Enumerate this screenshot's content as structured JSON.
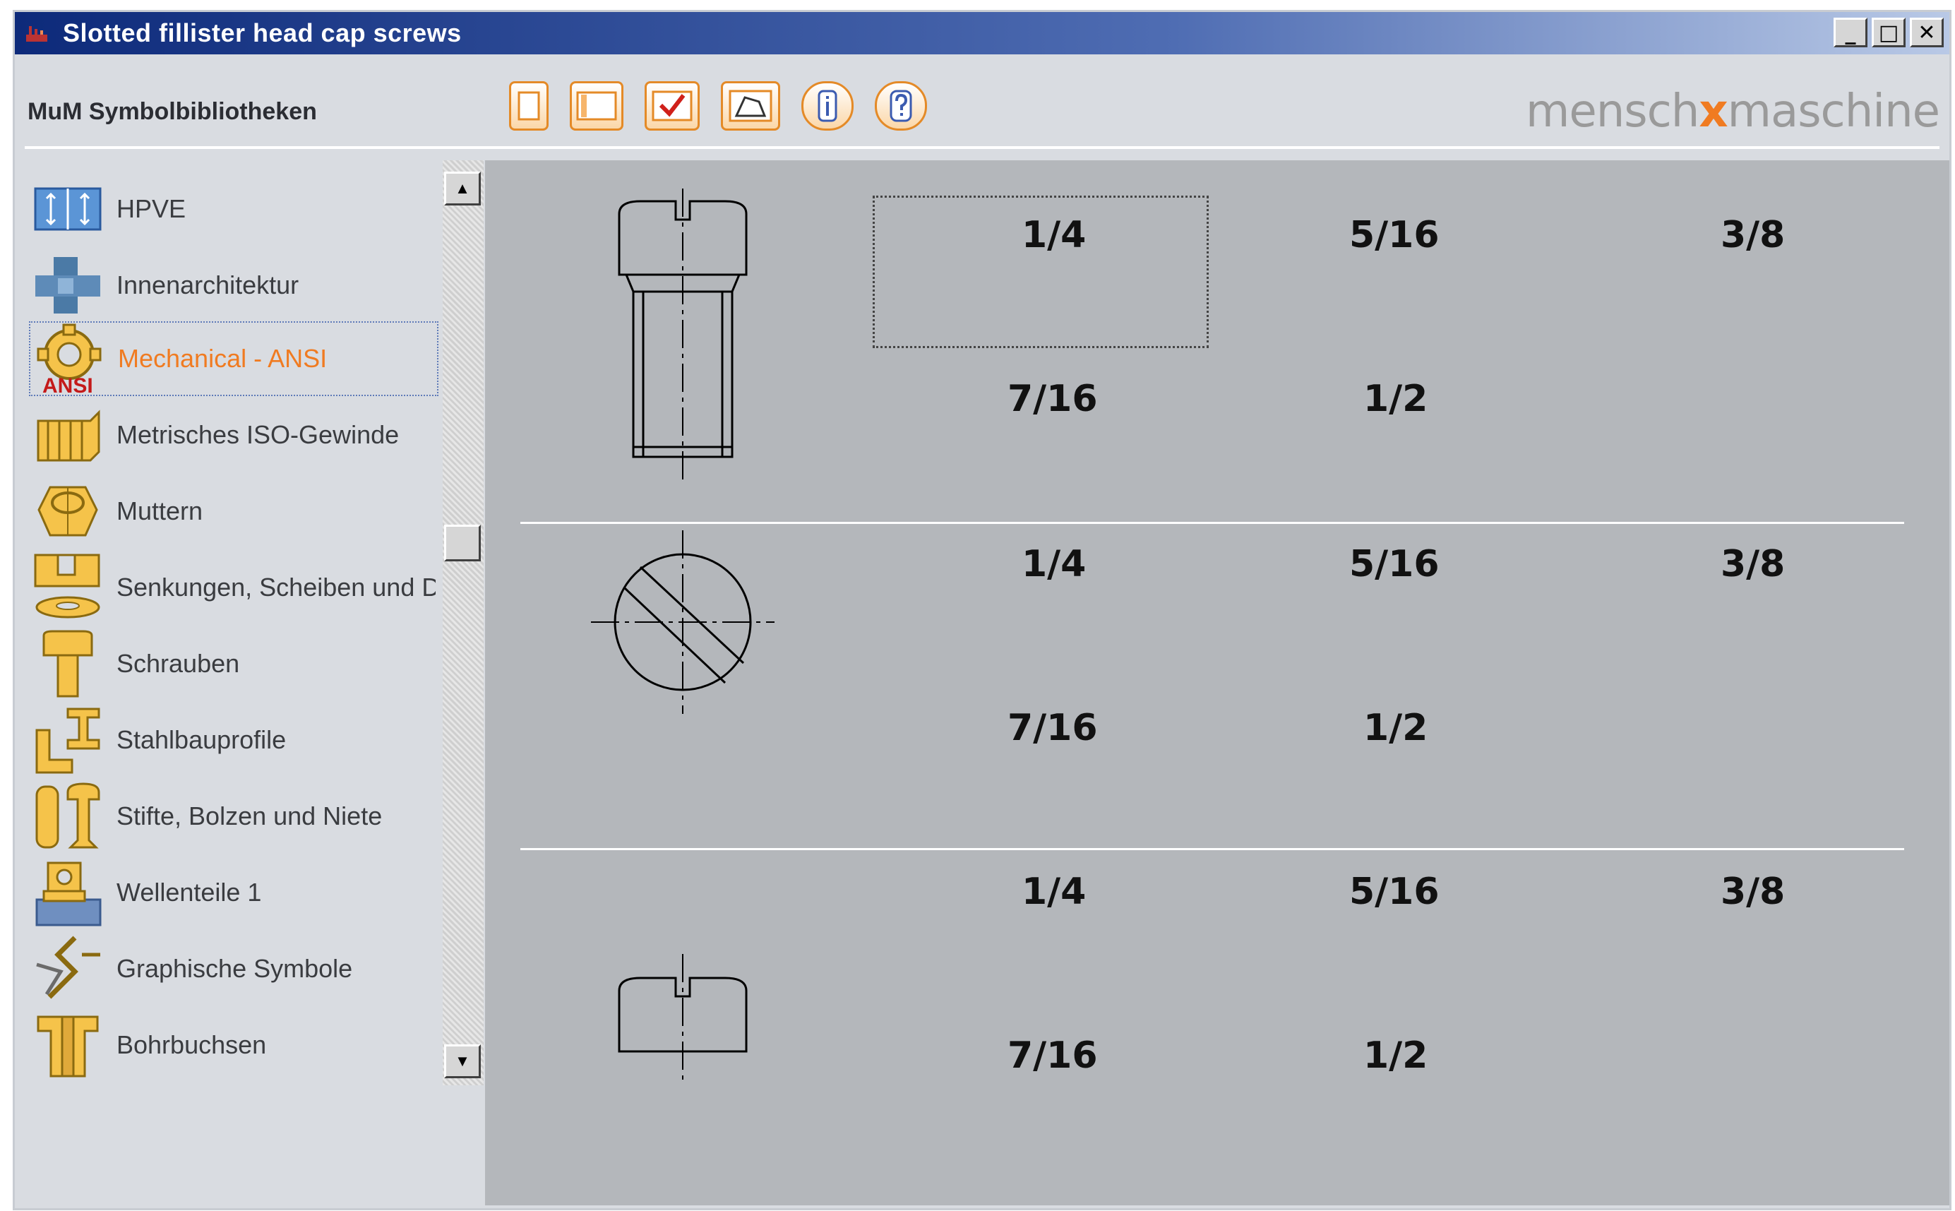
{
  "window": {
    "title": "Slotted fillister head cap screws",
    "controls": [
      "_",
      "□",
      "✕"
    ]
  },
  "header": {
    "library_title": "MuM Symbolbibliotheken",
    "brand_left": "mensch",
    "brand_mark": "x",
    "brand_right": "maschine",
    "toolbar": [
      {
        "name": "new-button",
        "icon": "blank-page-icon"
      },
      {
        "name": "open-button",
        "icon": "panel-icon"
      },
      {
        "name": "check-button",
        "icon": "checkmark-icon"
      },
      {
        "name": "insert-button",
        "icon": "shape-icon"
      },
      {
        "name": "info-button",
        "icon": "info-icon",
        "glyph": "i"
      },
      {
        "name": "help-button",
        "icon": "help-icon",
        "glyph": "?"
      }
    ]
  },
  "sidebar": {
    "items": [
      {
        "label": "HPVE",
        "icon": "hpve-icon"
      },
      {
        "label": "Innenarchitektur",
        "icon": "interior-icon"
      },
      {
        "label": "Mechanical - ANSI",
        "icon": "gear-ansi-icon",
        "badge": "ANSI",
        "selected": true
      },
      {
        "label": "Metrisches ISO-Gewinde",
        "icon": "thread-icon"
      },
      {
        "label": "Muttern",
        "icon": "nut-icon"
      },
      {
        "label": "Senkungen, Scheiben und Du",
        "icon": "washer-icon"
      },
      {
        "label": "Schrauben",
        "icon": "screw-icon"
      },
      {
        "label": "Stahlbauprofile",
        "icon": "steel-profile-icon"
      },
      {
        "label": "Stifte, Bolzen und Niete",
        "icon": "pin-icon"
      },
      {
        "label": "Wellenteile 1",
        "icon": "shaft-icon"
      },
      {
        "label": "Graphische Symbole",
        "icon": "graphic-symbol-icon"
      },
      {
        "label": "Bohrbuchsen",
        "icon": "bushing-icon"
      }
    ]
  },
  "main": {
    "rows": [
      {
        "view": "side-view",
        "sizes": [
          "1/4",
          "5/16",
          "3/8",
          "7/16",
          "1/2"
        ]
      },
      {
        "view": "top-view",
        "sizes": [
          "1/4",
          "5/16",
          "3/8",
          "7/16",
          "1/2"
        ]
      },
      {
        "view": "head-view",
        "sizes": [
          "1/4",
          "5/16",
          "3/8",
          "7/16",
          "1/2"
        ]
      }
    ]
  },
  "colors": {
    "accent": "#f07b21",
    "panel_bg": "#b4b7bb",
    "window_bg": "#d9dce1",
    "titlebar": "#0d2a7a"
  }
}
